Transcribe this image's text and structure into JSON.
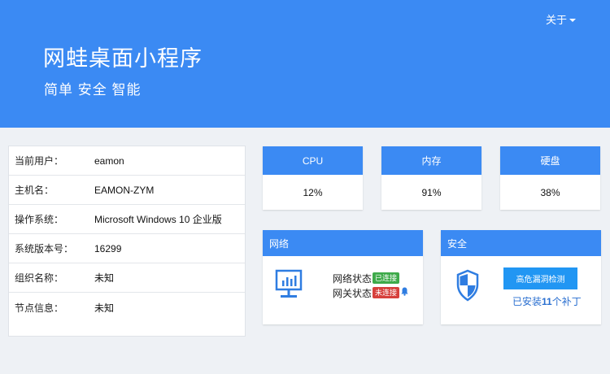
{
  "header": {
    "about_label": "关于",
    "title": "网蛙桌面小程序",
    "subtitle": "简单 安全 智能"
  },
  "system_info": [
    {
      "label": "当前用户：",
      "value": "eamon"
    },
    {
      "label": "主机名：",
      "value": "EAMON-ZYM"
    },
    {
      "label": "操作系统：",
      "value": "Microsoft Windows 10 企业版"
    },
    {
      "label": "系统版本号：",
      "value": "16299"
    },
    {
      "label": "组织名称：",
      "value": "未知"
    },
    {
      "label": "节点信息：",
      "value": "未知"
    }
  ],
  "metrics": {
    "cpu": {
      "label": "CPU",
      "value": "12%"
    },
    "memory": {
      "label": "内存",
      "value": "91%"
    },
    "disk": {
      "label": "硬盘",
      "value": "38%"
    }
  },
  "network": {
    "title": "网络",
    "network_status_label": "网络状态",
    "network_status_tag": "已连接",
    "gateway_status_label": "网关状态",
    "gateway_status_tag": "未连接"
  },
  "security": {
    "title": "安全",
    "scan_button": "高危漏洞检测",
    "patch_prefix": "已安装",
    "patch_count": "11",
    "patch_suffix": "个补丁"
  },
  "colors": {
    "primary": "#3b8af3",
    "button": "#2196f3",
    "connected": "#3eaa4a",
    "disconnected": "#d6403c"
  },
  "icons": {
    "network_panel": "monitor-chart-icon",
    "security_panel": "shield-icon",
    "gateway_alert": "bell-icon"
  }
}
